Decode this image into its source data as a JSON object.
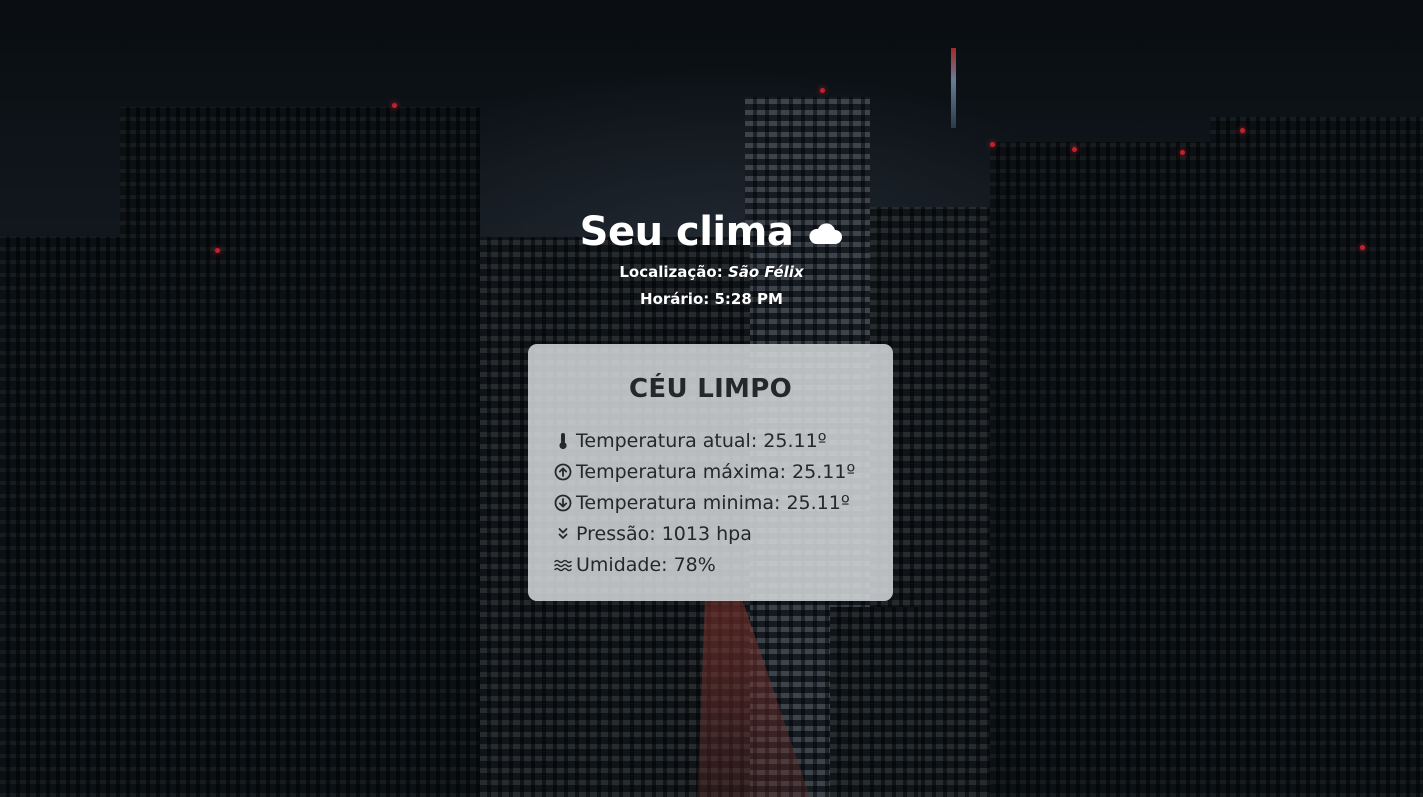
{
  "header": {
    "title": "Seu clima",
    "title_icon": "cloud-icon",
    "location_label": "Localização:",
    "location_value": "São Félix",
    "time_label": "Horário:",
    "time_value": "5:28 PM"
  },
  "card": {
    "condition": "CÉU LIMPO",
    "rows": [
      {
        "icon": "thermometer-icon",
        "text": "Temperatura atual: 25.11º"
      },
      {
        "icon": "arrow-up-circle-icon",
        "text": "Temperatura máxima: 25.11º"
      },
      {
        "icon": "arrow-down-circle-icon",
        "text": "Temperatura minima: 25.11º"
      },
      {
        "icon": "double-chevron-down-icon",
        "text": "Pressão: 1013 hpa"
      },
      {
        "icon": "waves-icon",
        "text": "Umidade: 78%"
      }
    ]
  },
  "colors": {
    "header_text": "#ffffff",
    "card_background": "#d6dadc",
    "card_text": "#25282b"
  }
}
